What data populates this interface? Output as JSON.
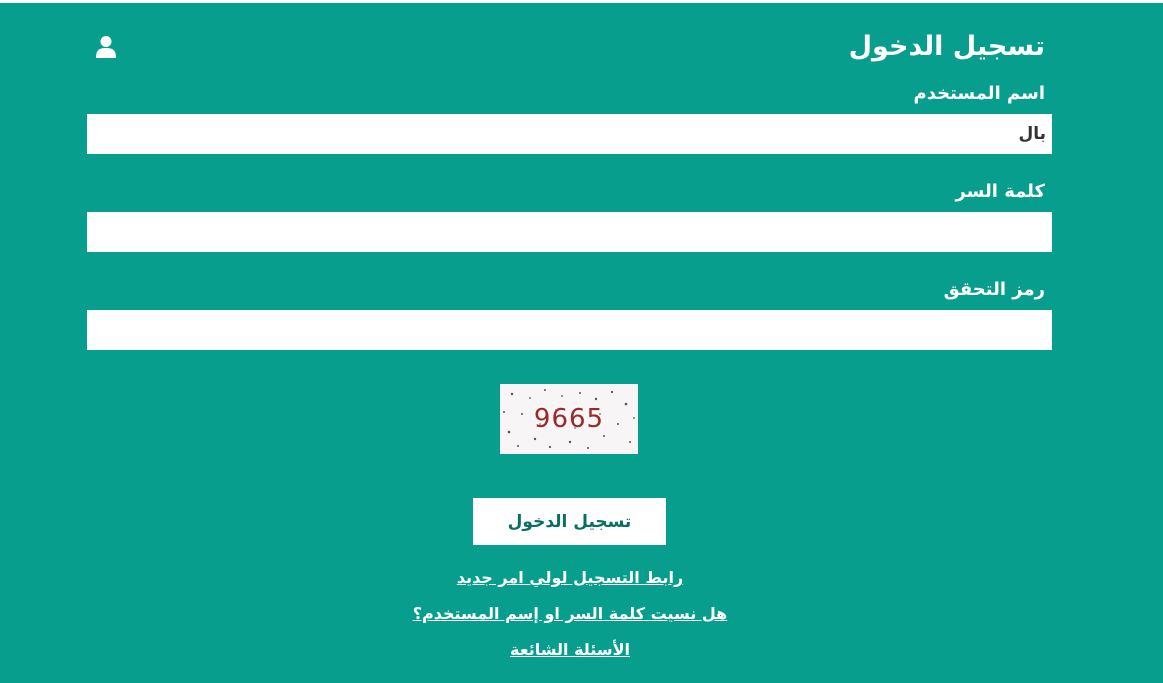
{
  "login": {
    "title": "تسجيل الدخول",
    "username_label": "اسم المستخدم",
    "username_value": "بال",
    "password_label": "كلمة السر",
    "password_value": "",
    "captcha_label": "رمز التحقق",
    "captcha_value": "",
    "captcha_code": "9665",
    "submit_label": "تسجيل الدخول"
  },
  "links": {
    "parent_registration": "رابط التسجيل لولي امر جديد",
    "forgot_credentials": "هل نسيت كلمة السر او إسم المستخدم؟",
    "faq": "الأسئلة الشائعة"
  },
  "icons": {
    "user": "user-icon"
  },
  "colors": {
    "panel_background": "#079e8d",
    "button_text": "#0a6f63",
    "captcha_text": "#9a2a2a"
  }
}
